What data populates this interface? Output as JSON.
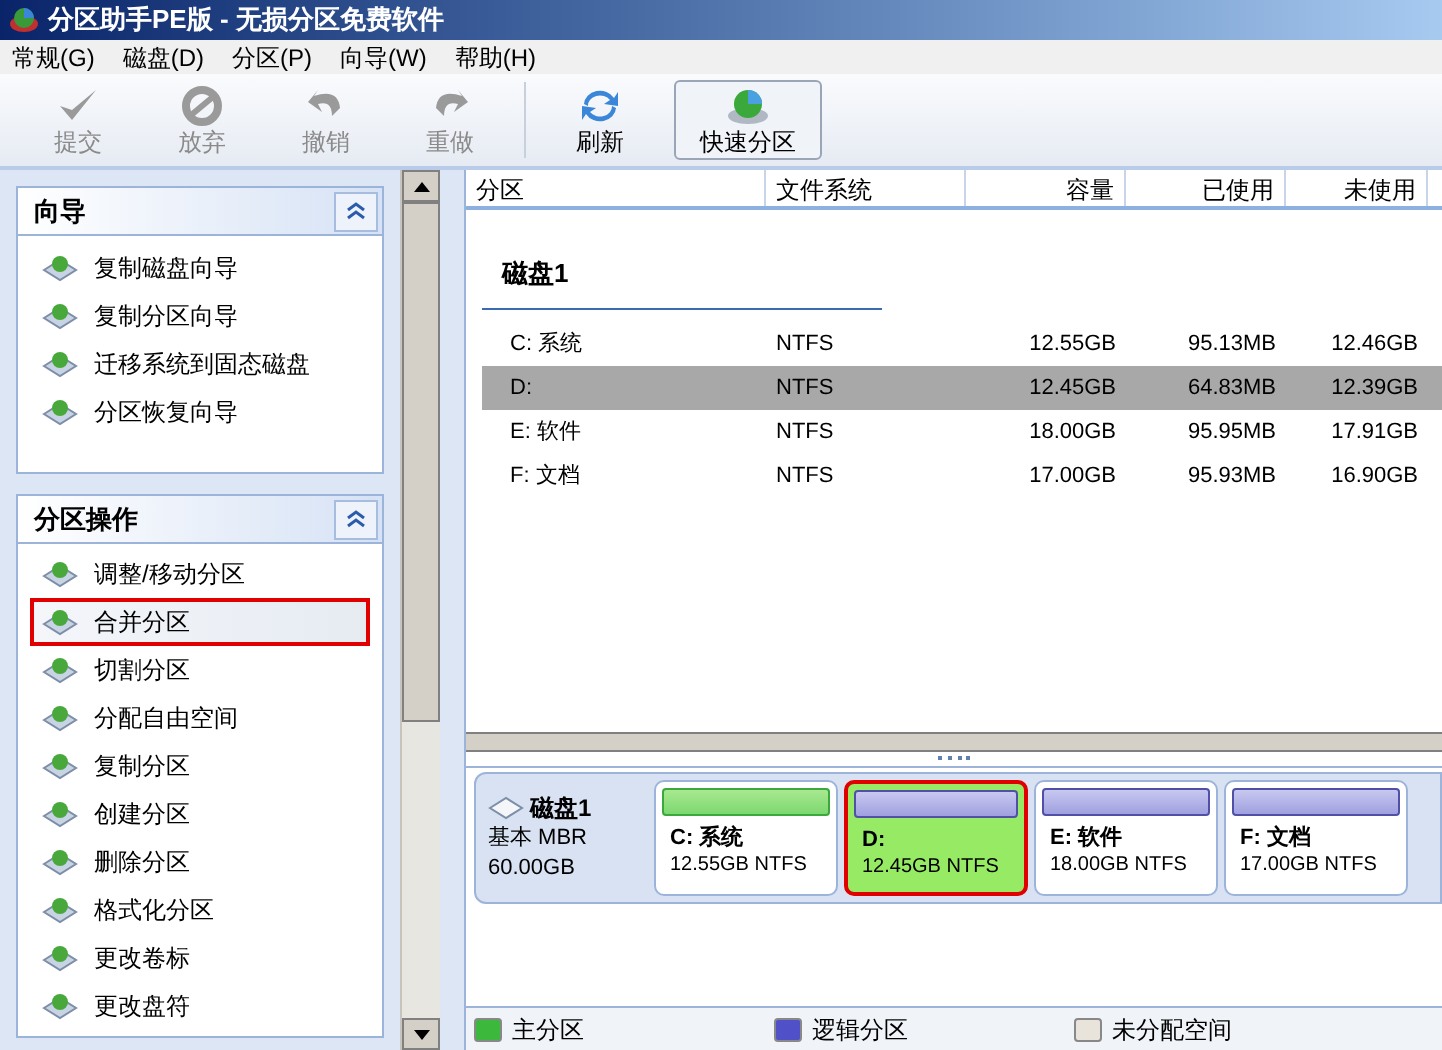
{
  "window": {
    "title": "分区助手PE版 - 无损分区免费软件"
  },
  "menu": [
    "常规(G)",
    "磁盘(D)",
    "分区(P)",
    "向导(W)",
    "帮助(H)"
  ],
  "toolbar": [
    {
      "label": "提交",
      "kind": "check",
      "disabled": true
    },
    {
      "label": "放弃",
      "kind": "discard",
      "disabled": true
    },
    {
      "label": "撤销",
      "kind": "undo",
      "disabled": true
    },
    {
      "label": "重做",
      "kind": "redo",
      "disabled": true
    },
    {
      "label": "刷新",
      "kind": "refresh",
      "disabled": false
    },
    {
      "label": "快速分区",
      "kind": "quick",
      "disabled": false
    }
  ],
  "sidebar": {
    "panels": [
      {
        "title": "向导",
        "items": [
          {
            "label": "复制磁盘向导",
            "selected": false
          },
          {
            "label": "复制分区向导",
            "selected": false
          },
          {
            "label": "迁移系统到固态磁盘",
            "selected": false
          },
          {
            "label": "分区恢复向导",
            "selected": false
          }
        ]
      },
      {
        "title": "分区操作",
        "items": [
          {
            "label": "调整/移动分区",
            "selected": false
          },
          {
            "label": "合并分区",
            "selected": true
          },
          {
            "label": "切割分区",
            "selected": false
          },
          {
            "label": "分配自由空间",
            "selected": false
          },
          {
            "label": "复制分区",
            "selected": false
          },
          {
            "label": "创建分区",
            "selected": false
          },
          {
            "label": "删除分区",
            "selected": false
          },
          {
            "label": "格式化分区",
            "selected": false
          },
          {
            "label": "更改卷标",
            "selected": false
          },
          {
            "label": "更改盘符",
            "selected": false
          }
        ]
      }
    ]
  },
  "table": {
    "columns": [
      "分区",
      "文件系统",
      "容量",
      "已使用",
      "未使用"
    ],
    "disk_label": "磁盘1",
    "rows": [
      {
        "cells": [
          "C: 系统",
          "NTFS",
          "12.55GB",
          "95.13MB",
          "12.46GB"
        ],
        "selected": false
      },
      {
        "cells": [
          "D:",
          "NTFS",
          "12.45GB",
          "64.83MB",
          "12.39GB"
        ],
        "selected": true
      },
      {
        "cells": [
          "E: 软件",
          "NTFS",
          "18.00GB",
          "95.95MB",
          "17.91GB"
        ],
        "selected": false
      },
      {
        "cells": [
          "F: 文档",
          "NTFS",
          "17.00GB",
          "95.93MB",
          "16.90GB"
        ],
        "selected": false
      }
    ]
  },
  "disk_map": {
    "disk": {
      "name": "磁盘1",
      "type": "基本 MBR",
      "size": "60.00GB"
    },
    "partitions": [
      {
        "name": "C: 系统",
        "info": "12.55GB NTFS",
        "kind": "primary",
        "selected": false
      },
      {
        "name": "D:",
        "info": "12.45GB NTFS",
        "kind": "logical",
        "selected": true
      },
      {
        "name": "E: 软件",
        "info": "18.00GB NTFS",
        "kind": "logical",
        "selected": false
      },
      {
        "name": "F: 文档",
        "info": "17.00GB NTFS",
        "kind": "logical",
        "selected": false
      }
    ]
  },
  "legend": [
    {
      "label": "主分区",
      "color": "#3cb83c"
    },
    {
      "label": "逻辑分区",
      "color": "#5050c8"
    },
    {
      "label": "未分配空间",
      "color": "#e8e4dc"
    }
  ]
}
